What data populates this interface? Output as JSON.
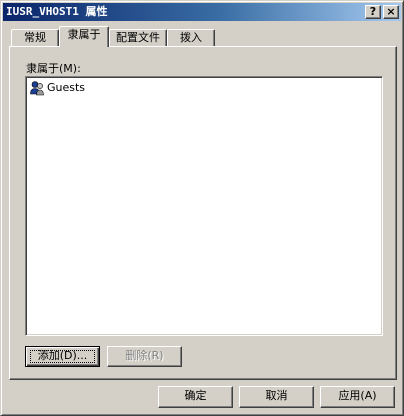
{
  "window": {
    "title": "IUSR_VHOST1 属性",
    "help_button": "?",
    "close_button": "×"
  },
  "tabs": [
    {
      "label": "常规",
      "active": false
    },
    {
      "label": "隶属于",
      "active": true
    },
    {
      "label": "配置文件",
      "active": false
    },
    {
      "label": "拨入",
      "active": false
    }
  ],
  "member_of": {
    "label": "隶属于(M):",
    "items": [
      {
        "label": "Guests",
        "icon": "user-group-icon"
      }
    ],
    "add_button": "添加(D)...",
    "remove_button": "删除(R)"
  },
  "footer": {
    "ok_button": "确定",
    "cancel_button": "取消",
    "apply_button": "应用(A)"
  },
  "colors": {
    "face": "#d4d0c8",
    "title_start": "#0a246a",
    "title_end": "#a6caf0",
    "list_bg": "#ffffff"
  }
}
